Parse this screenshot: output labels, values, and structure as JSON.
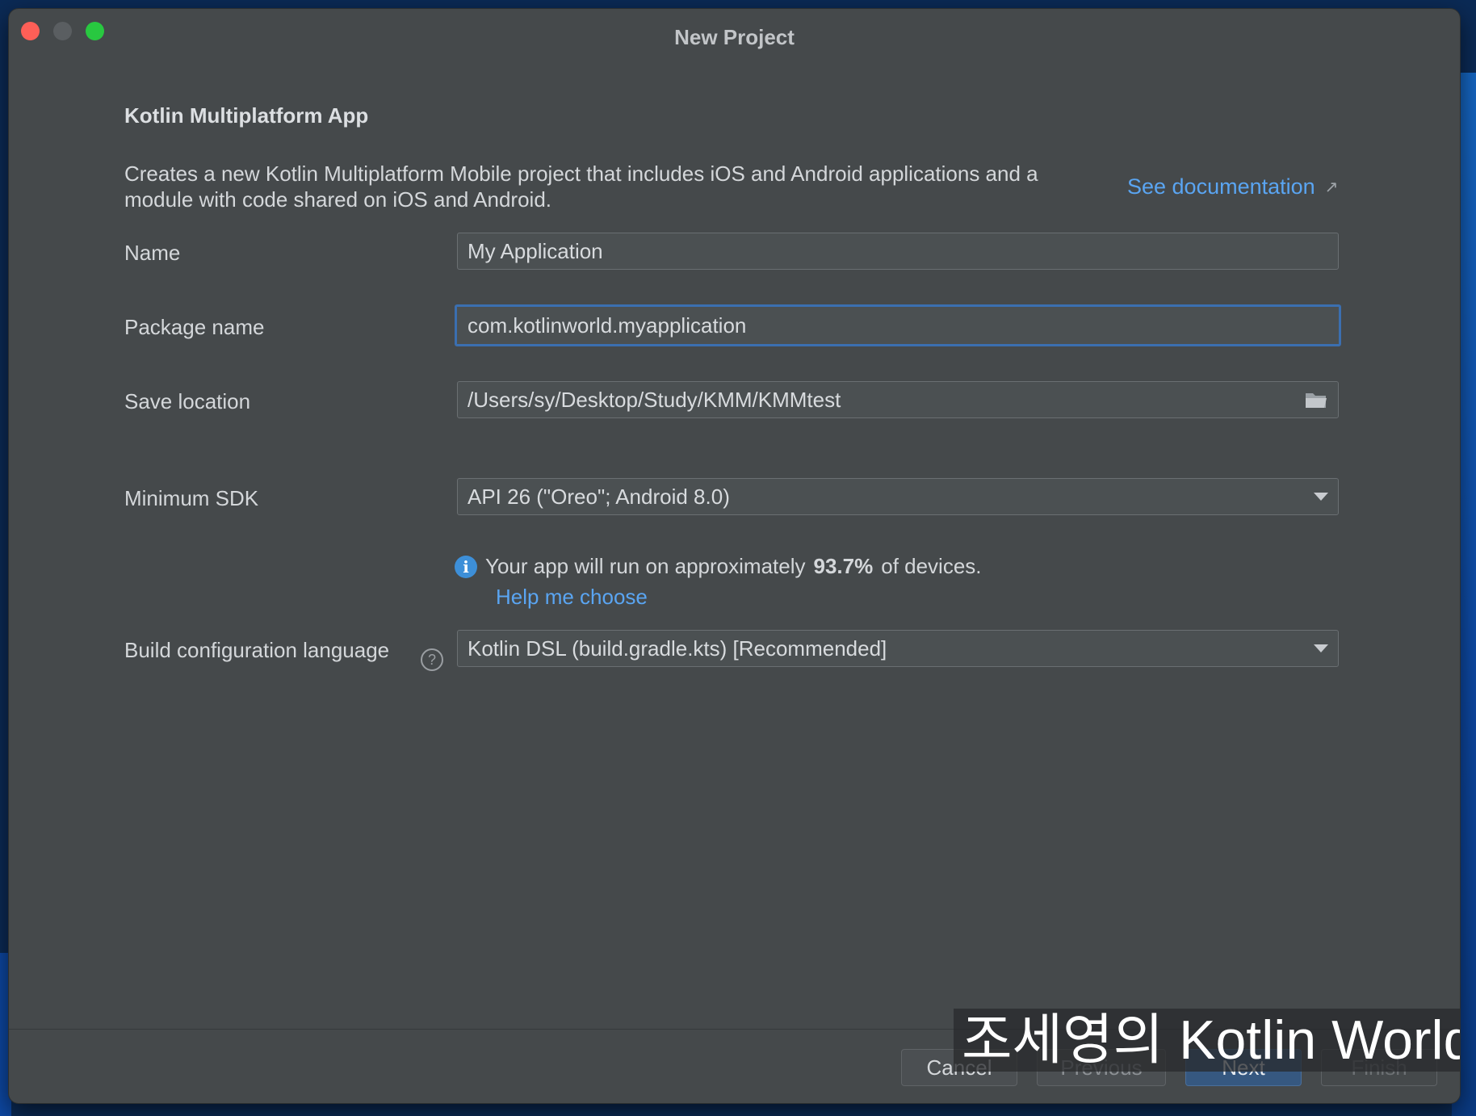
{
  "window": {
    "title": "New Project"
  },
  "header": {
    "heading": "Kotlin Multiplatform App",
    "description": "Creates a new Kotlin Multiplatform Mobile project that includes iOS and Android applications and a module with code shared on iOS and Android.",
    "doc_link": "See documentation",
    "doc_link_icon": "external-link-arrow"
  },
  "form": {
    "name": {
      "label": "Name",
      "value": "My Application"
    },
    "package": {
      "label": "Package name",
      "value": "com.kotlinworld.myapplication"
    },
    "save_location": {
      "label": "Save location",
      "value": "/Users/sy/Desktop/Study/KMM/KMMtest",
      "icon": "folder-icon"
    },
    "min_sdk": {
      "label": "Minimum SDK",
      "value": "API 26 (\"Oreo\"; Android 8.0)"
    },
    "info": {
      "prefix": "Your app will run on approximately",
      "percent": "93.7%",
      "suffix": "of devices.",
      "help_link": "Help me choose"
    },
    "build_lang": {
      "label": "Build configuration language",
      "value": "Kotlin DSL (build.gradle.kts) [Recommended]",
      "help_icon": "?"
    }
  },
  "buttons": {
    "cancel": "Cancel",
    "previous": "Previous",
    "next": "Next",
    "finish": "Finish"
  },
  "watermark": "조세영의 Kotlin World",
  "colors": {
    "window_bg": "#45494b",
    "link": "#5aa5f2",
    "focus_border": "#3b6fb0",
    "next_button": "#365880"
  }
}
